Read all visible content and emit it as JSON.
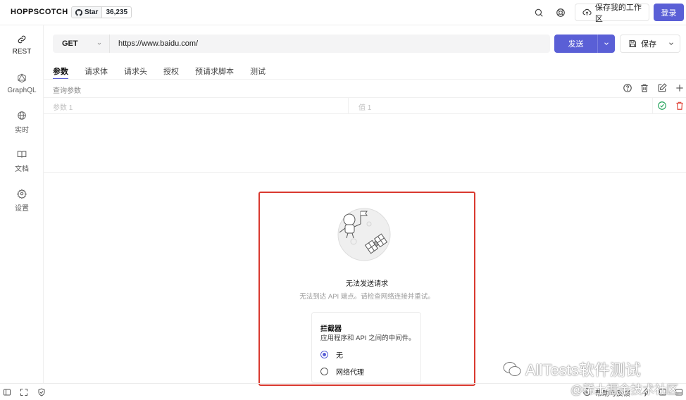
{
  "app": {
    "brand": "HOPPSCOTCH"
  },
  "github": {
    "star_label": "Star",
    "count": "36,235"
  },
  "header": {
    "save_workspace": "保存我的工作区",
    "login": "登录"
  },
  "sidebar": {
    "items": [
      {
        "label": "REST",
        "icon": "link-icon"
      },
      {
        "label": "GraphQL",
        "icon": "graphql-icon"
      },
      {
        "label": "实时",
        "icon": "globe-icon"
      },
      {
        "label": "文档",
        "icon": "book-icon"
      },
      {
        "label": "设置",
        "icon": "gear-icon"
      }
    ]
  },
  "request": {
    "method": "GET",
    "url": "https://www.baidu.com/",
    "send_label": "发送",
    "save_label": "保存"
  },
  "tabs": [
    "参数",
    "请求体",
    "请求头",
    "授权",
    "预请求脚本",
    "测试"
  ],
  "params": {
    "section_label": "查询参数",
    "key_placeholder": "参数 1",
    "value_placeholder": "值 1"
  },
  "response": {
    "error_title": "无法发送请求",
    "error_subtitle": "无法到达 API 端点。请检查网络连接并重试。",
    "interceptor": {
      "title": "拦截器",
      "description": "应用程序和 API 之间的中间件。",
      "options": [
        "无",
        "网络代理"
      ],
      "selected": "无"
    }
  },
  "footer": {
    "help": "帮助与反馈"
  },
  "watermark": {
    "line1": "AllTests软件测试",
    "line2": "@稀土掘金技术社区"
  },
  "colors": {
    "accent": "#5a5fd6",
    "highlight_border": "#d9392f",
    "success": "#22a35a",
    "danger": "#e0453a"
  }
}
